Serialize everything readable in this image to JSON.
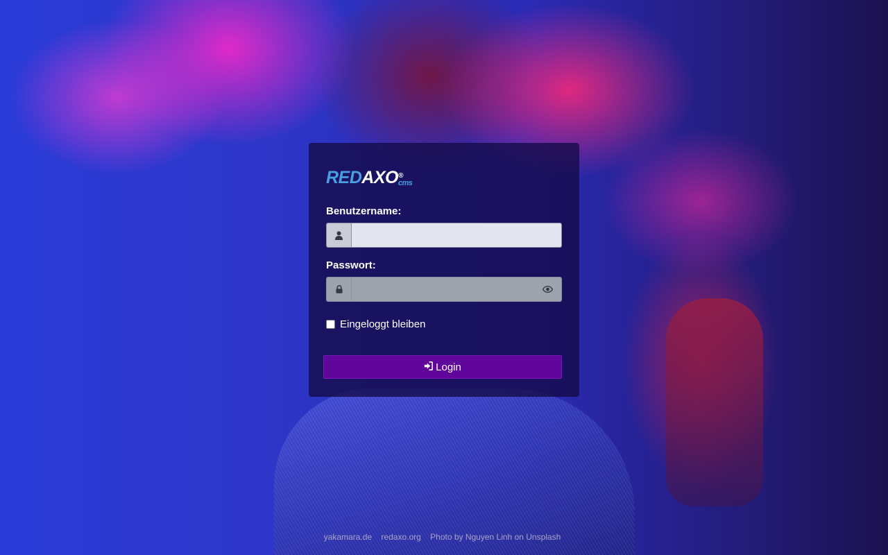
{
  "logo": {
    "brand_part1": "RED",
    "brand_part2": "AXO",
    "registered": "®",
    "suffix": "cms"
  },
  "login_form": {
    "username_label": "Benutzername:",
    "username_value": "",
    "username_icon": "user-icon",
    "password_label": "Passwort:",
    "password_value": "",
    "password_icon": "lock-icon",
    "show_password_icon": "eye-icon",
    "remember_label": "Eingeloggt bleiben",
    "remember_checked": false,
    "submit_label": "Login",
    "submit_icon": "sign-in-icon"
  },
  "footer": {
    "links": [
      "yakamara.de",
      "redaxo.org",
      "Photo by Nguyen Linh on Unsplash"
    ]
  },
  "colors": {
    "brand_blue": "#4a9ee2",
    "button_purple": "#61069a",
    "panel_bg": "#140a46"
  }
}
